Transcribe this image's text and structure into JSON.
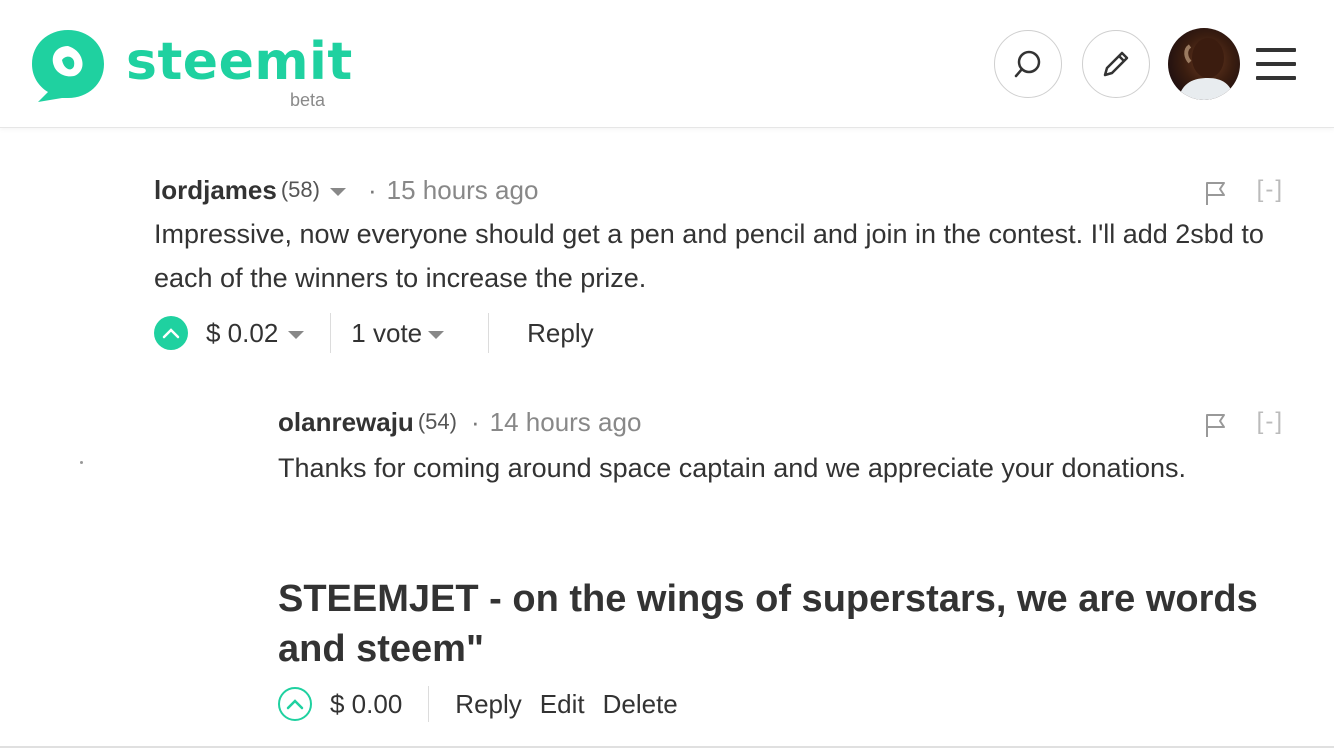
{
  "app": {
    "logo_text": "steemit",
    "logo_sub": "beta",
    "brand_color": "#1fd1a0"
  },
  "header": {
    "search_icon": "search-icon",
    "edit_icon": "pencil-icon",
    "menu_icon": "hamburger-icon"
  },
  "comments": [
    {
      "author": "lordjames",
      "reputation": "(58)",
      "separator": "·",
      "time": "15 hours ago",
      "collapse": "[-]",
      "body": "Impressive, now everyone should get a pen and pencil and join in the contest. I'll add 2sbd to each of the winners to increase the prize.",
      "payout": "$ 0.02",
      "votes": "1 vote",
      "reply_label": "Reply"
    },
    {
      "author": "olanrewaju",
      "reputation": "(54)",
      "separator": "·",
      "time": "14 hours ago",
      "collapse": "[-]",
      "body": "Thanks for coming around space captain and we appreciate your donations."
    }
  ],
  "post": {
    "title": "STEEMJET - on the wings of superstars, we are words and steem\"",
    "payout": "$ 0.00",
    "reply_label": "Reply",
    "edit_label": "Edit",
    "delete_label": "Delete"
  }
}
